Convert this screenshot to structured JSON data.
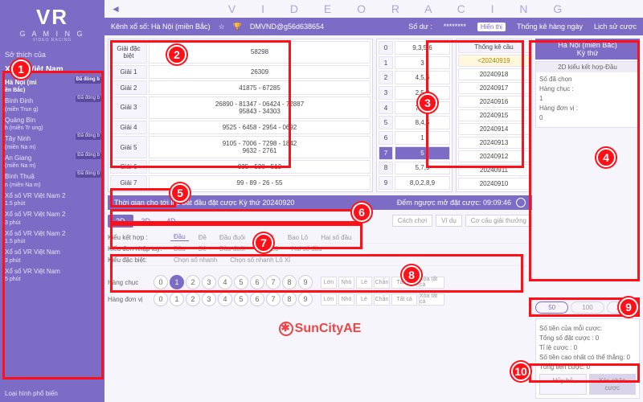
{
  "brand": {
    "title": "VR",
    "sub": "G A M I N G",
    "tiny": "VIDEO RACING",
    "topband": "V I D E O   R A C I N G"
  },
  "sidebar": {
    "fav": "Sở thích của",
    "section": "Xổ số Việt Nam",
    "items": [
      {
        "l1": "Hà Nội (mi",
        "l2": "ền Bắc)",
        "tag": "Đã đóng b"
      },
      {
        "l1": "Bình Định",
        "l2": "(miền Trun g)",
        "tag": "Đã đóng b"
      },
      {
        "l1": "Quảng Bìn",
        "l2": "h (miền Tr ung)",
        "tag": ""
      },
      {
        "l1": "Tây Ninh",
        "l2": "(miền Na m)",
        "tag": "Đã đóng b"
      },
      {
        "l1": "An Giang",
        "l2": "(miền Na m)",
        "tag": "Đã đóng b"
      },
      {
        "l1": "Bình Thuậ",
        "l2": "n (miền Na m)",
        "tag": "Đã đóng b"
      },
      {
        "l1": "Xổ số VR Việt Nam 2",
        "l2": "1.5 phút",
        "tag": ""
      },
      {
        "l1": "Xổ số VR Việt Nam 2",
        "l2": "3 phút",
        "tag": ""
      },
      {
        "l1": "Xổ số VR Việt Nam 2",
        "l2": "1.5 phút",
        "tag": ""
      },
      {
        "l1": "Xổ số VR Việt Nam",
        "l2": "3 phút",
        "tag": ""
      },
      {
        "l1": "Xổ số VR Việt Nam",
        "l2": "5 phút",
        "tag": ""
      }
    ],
    "foot": "Loại hình phổ biến"
  },
  "topbar": {
    "channel": "Kênh xổ số: Hà Nội (miền Bắc)",
    "acct_lbl": "DMVND@g56d638654",
    "bal_lbl": "Số dư :",
    "bal_mask": "********",
    "show": "Hiển thị",
    "stat": "Thống kê hàng ngày",
    "hist": "Lịch sử cược"
  },
  "prize": {
    "rows": [
      [
        "Giải đặc biệt",
        "58298"
      ],
      [
        "Giải 1",
        "26309"
      ],
      [
        "Giải 2",
        "41875 - 67285"
      ],
      [
        "Giải 3",
        "26890 - 81347 - 06424 - 72887\n95843 - 34303"
      ],
      [
        "Giải 4",
        "9525 - 6458 - 2954 - 0692"
      ],
      [
        "Giải 5",
        "9105 - 7006 - 7298 - 1842\n9632 - 2761"
      ],
      [
        "Giải 6",
        "935 - 538 - 513"
      ],
      [
        "Giải 7",
        "99 - 89 - 26 - 55"
      ]
    ]
  },
  "digits": {
    "rows": [
      [
        "0",
        "9,3,5,6"
      ],
      [
        "1",
        "3"
      ],
      [
        "2",
        "4,5,6"
      ],
      [
        "3",
        "2,5,8"
      ],
      [
        "4",
        "7,3,2"
      ],
      [
        "5",
        "8,4,5"
      ],
      [
        "6",
        "1"
      ],
      [
        "7",
        "5"
      ],
      [
        "8",
        "5,7,9"
      ],
      [
        "9",
        "8,0,2,8,9"
      ]
    ],
    "selected": 7
  },
  "stats": {
    "title": "Thống kê cầu",
    "rows": [
      "<20240919",
      "20240918",
      "20240917",
      "20240916",
      "20240915",
      "20240914",
      "20240913",
      "20240912",
      "20240911",
      "20240910"
    ],
    "selected": 0
  },
  "msgbar": {
    "l": "Thời gian cho tới lúc bắt đầu đặt cược Kỳ thứ 20240920",
    "r": "Đếm ngược mở đặt cược: 09:09:46"
  },
  "dims": {
    "tabs": [
      "2D",
      "3D",
      "4D"
    ],
    "help": [
      "Cách chơi",
      "Ví dụ",
      "Cơ cấu giải thưởng"
    ]
  },
  "filters": [
    {
      "lbl": "Kiểu kết hợp :",
      "opts": [
        "Đầu",
        "Đề",
        "Đầu đuôi",
        "Giải 1",
        "Bao Lô",
        "Hai số đầu"
      ],
      "active": 0
    },
    {
      "lbl": "Kiểu đơn nhập tay:",
      "opts": [
        "Đầu",
        "Đề",
        "Đầu đuôi",
        "Bao Lô",
        "Hai số đầu"
      ],
      "active": -1
    },
    {
      "lbl": "Kiểu đặc biệt:",
      "opts": [
        "Chọn số nhanh",
        "Chọn số nhanh Lô Xỉ"
      ],
      "active": -1
    }
  ],
  "numpad": {
    "rows": [
      {
        "lbl": "Hàng chục",
        "sel": 1
      },
      {
        "lbl": "Hàng đơn vị",
        "sel": -1
      }
    ],
    "digits": [
      "0",
      "1",
      "2",
      "3",
      "4",
      "5",
      "6",
      "7",
      "8",
      "9"
    ],
    "quick": [
      "Lớn",
      "Nhỏ",
      "Lẻ",
      "Chẵn",
      "Tất cả",
      "Xóa tất cả"
    ]
  },
  "footerlogo": "SunCityAE",
  "right": {
    "title1": "Hà Nội (miền Bắc)",
    "title2": "Kỳ thứ",
    "mode": "2D kiểu kết hợp-Đầu",
    "chosen_lbl": "Số đã chọn",
    "tens_lbl": "Hàng chục :",
    "tens_val": "1",
    "unit_lbl": "Hàng đơn vị :",
    "unit_val": "0",
    "chips": [
      "50",
      "100",
      "1000"
    ],
    "amt_lbl": "Số tiền của mỗi cược:",
    "sum": [
      [
        "Tổng số đặt cược :",
        "0"
      ],
      [
        "Tỉ lệ cược :",
        "0"
      ],
      [
        "Số tiền cao nhất có thể thắng:",
        "0"
      ],
      [
        "Tổng tiền cược:",
        "0"
      ]
    ],
    "cancel": "Hủy bỏ",
    "confirm": "Xác nhận cược"
  },
  "callouts": [
    "1",
    "2",
    "3",
    "4",
    "5",
    "6",
    "7",
    "8",
    "9",
    "10"
  ]
}
